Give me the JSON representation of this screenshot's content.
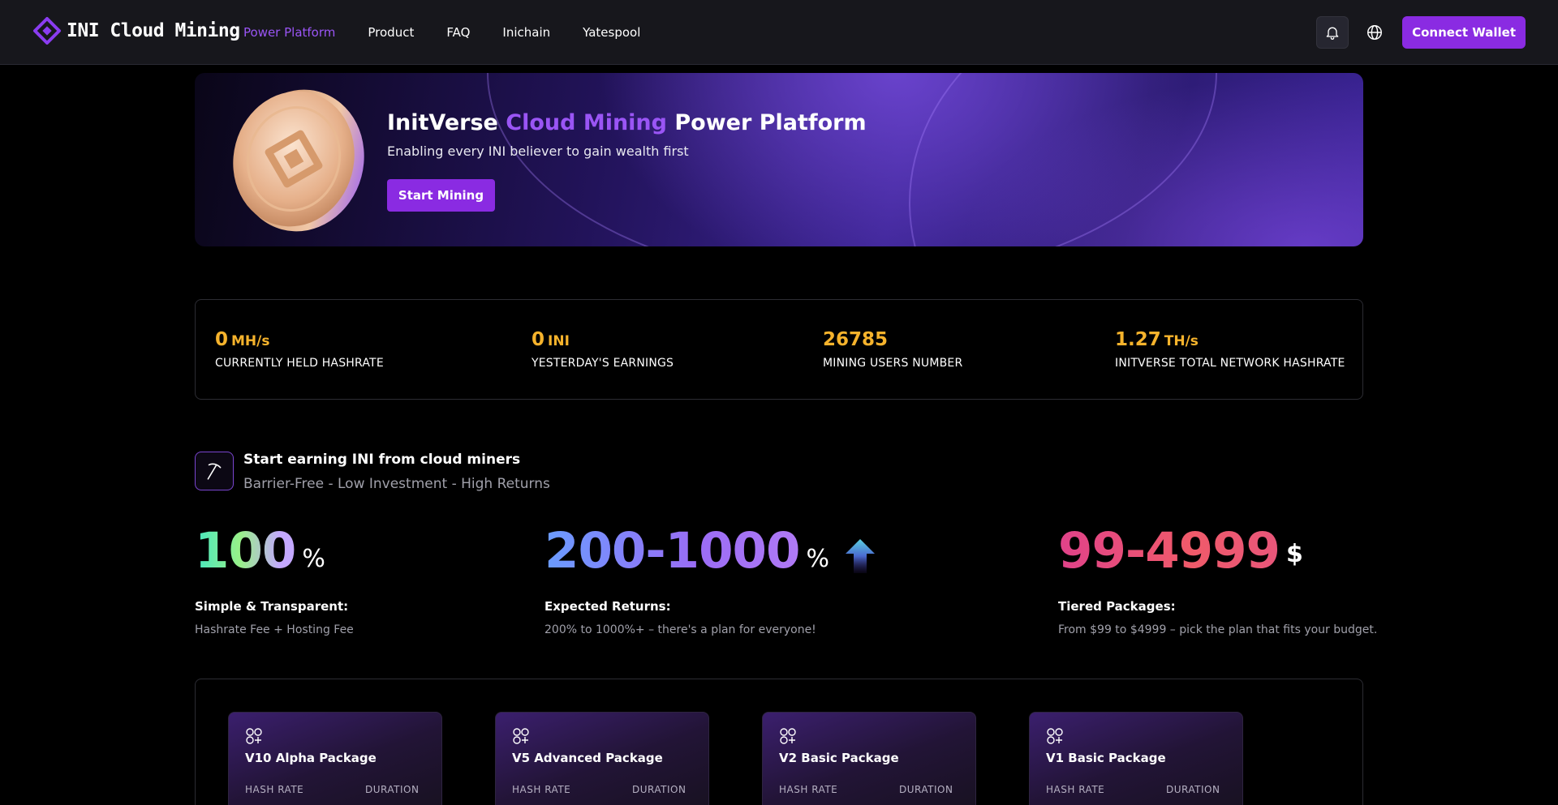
{
  "header": {
    "logo_text": "INI Cloud Mining",
    "nav": [
      {
        "label": "Power Platform",
        "active": true
      },
      {
        "label": "Product",
        "active": false
      },
      {
        "label": "FAQ",
        "active": false
      },
      {
        "label": "Inichain",
        "active": false
      },
      {
        "label": "Yatespool",
        "active": false
      }
    ],
    "bell_icon": "bell-icon",
    "language_icon": "globe-icon",
    "connect_wallet": "Connect Wallet"
  },
  "hero": {
    "title_prefix": "InitVerse",
    "title_accent": "Cloud Mining",
    "title_suffix": "Power Platform",
    "subtitle": "Enabling every INI believer to gain wealth first",
    "start_button": "Start Mining",
    "coin_icon": "ini-coin-icon"
  },
  "stats": [
    {
      "value": "0",
      "unit": "MH/s",
      "label": "CURRENTLY HELD HASHRATE"
    },
    {
      "value": "0",
      "unit": "INI",
      "label": "YESTERDAY'S EARNINGS"
    },
    {
      "value": "26785",
      "unit": "",
      "label": "MINING USERS NUMBER"
    },
    {
      "value": "1.27",
      "unit": "TH/s",
      "label": "INITVERSE TOTAL NETWORK HASHRATE"
    }
  ],
  "earn": {
    "icon": "pickaxe-icon",
    "title": "Start earning INI from cloud miners",
    "subtitle": "Barrier-Free - Low Investment - High Returns"
  },
  "features": [
    {
      "number": "100",
      "unit": "%",
      "title": "Simple & Transparent:",
      "desc": "Hashrate Fee + Hosting Fee"
    },
    {
      "number": "200-1000",
      "unit": "%",
      "title": "Expected Returns:",
      "desc": "200% to 1000%+ – there's a plan for everyone!"
    },
    {
      "number": "99-4999",
      "unit": "$",
      "title": "Tiered Packages:",
      "desc": "From $99 to $4999 – pick the plan that fits your budget."
    }
  ],
  "colors": {
    "accent": "#8a2be2",
    "accent_text": "#9a55f5",
    "stat_value": "#f6b32c"
  },
  "packages": [
    {
      "name": "V10 Alpha Package",
      "hash_rate_label": "HASH RATE",
      "duration_label": "DURATION"
    },
    {
      "name": "V5 Advanced Package",
      "hash_rate_label": "HASH RATE",
      "duration_label": "DURATION"
    },
    {
      "name": "V2 Basic Package",
      "hash_rate_label": "HASH RATE",
      "duration_label": "DURATION"
    },
    {
      "name": "V1 Basic Package",
      "hash_rate_label": "HASH RATE",
      "duration_label": "DURATION"
    }
  ]
}
